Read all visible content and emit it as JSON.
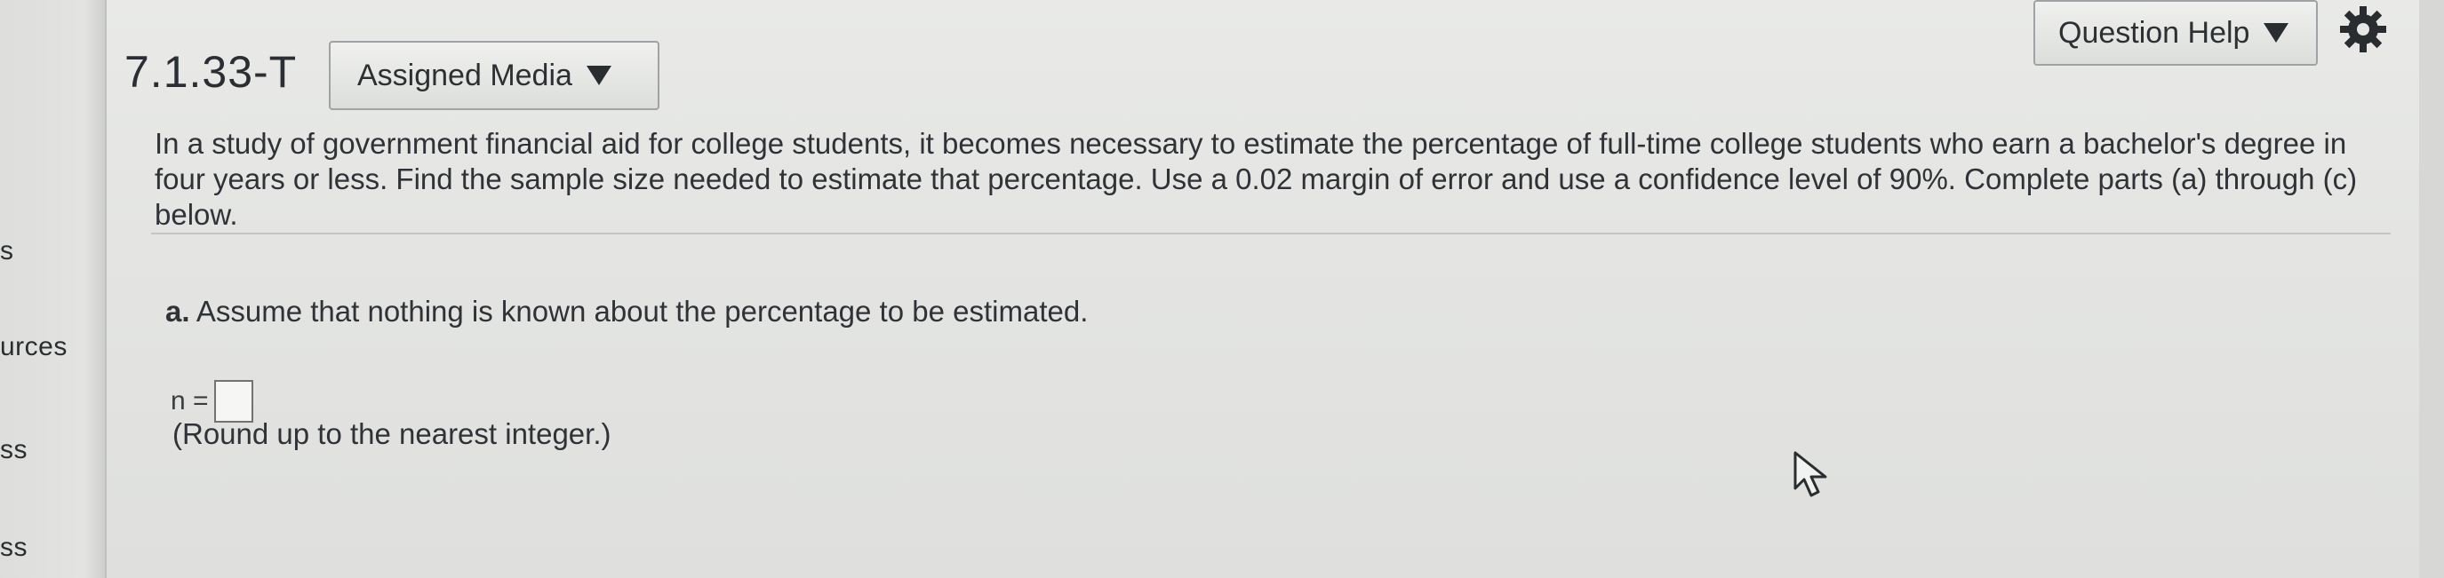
{
  "left_nav": {
    "items": [
      "s",
      "urces",
      "ss",
      "ss"
    ]
  },
  "question": {
    "id": "7.1.33-T",
    "assigned_media_label": "Assigned Media",
    "help_label": "Question Help",
    "prompt": "In a study of government financial aid for college students, it becomes necessary to estimate the percentage of full-time college students who earn a bachelor's degree in four years or less. Find the sample size needed to estimate that percentage. Use a 0.02 margin of error and use a confidence level of 90%. Complete parts (a) through (c) below.",
    "part_a": {
      "letter": "a.",
      "text": "Assume that nothing is known about the percentage to be estimated.",
      "answer_label": "n =",
      "answer_value": "",
      "note": "(Round up to the nearest integer.)"
    }
  },
  "icons": {
    "gear": "gear-icon",
    "dropdown": "caret-down-icon",
    "cursor": "pointer-cursor-icon"
  }
}
